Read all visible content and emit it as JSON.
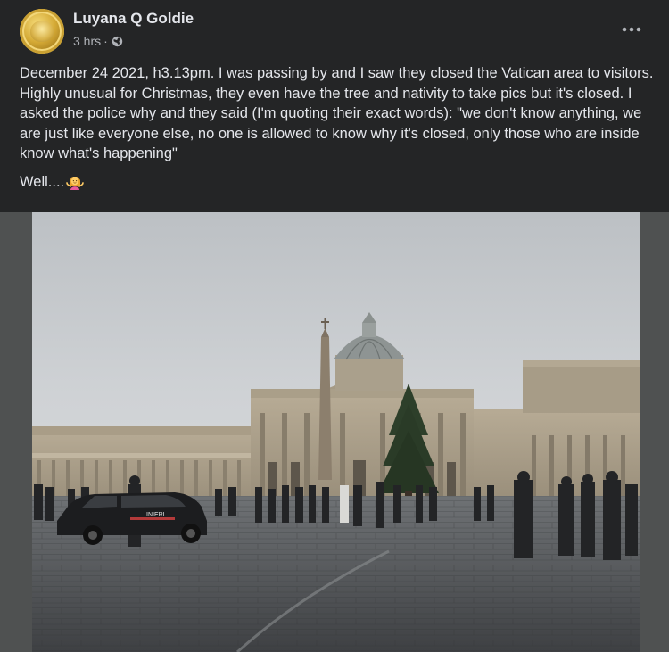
{
  "post": {
    "author": "Luyana Q Goldie",
    "time": "3 hrs",
    "separator": "·",
    "privacy_icon": "globe-icon",
    "more_icon": "more-horizontal-icon",
    "text_paragraph_1": "December 24 2021, h3.13pm. I was passing by and I saw they closed the Vatican area to visitors. Highly unusual for Christmas, they even have the tree and nativity to take pics but it's closed. I asked the police why and they said (I'm quoting their exact words): \"we don't know anything, we are just like everyone else, no one is allowed to know why it's closed, only those who are inside know what's happening\"",
    "text_paragraph_2": "Well....",
    "emoji_icon": "woman-shrugging-emoji-icon",
    "photo_subject": "St. Peter's Square photo",
    "police_car_text": "INIERI"
  },
  "colors": {
    "background": "#242526",
    "primary_text": "#e4e6eb",
    "secondary_text": "#b0b3b8",
    "media_frame": "#4f5151"
  }
}
